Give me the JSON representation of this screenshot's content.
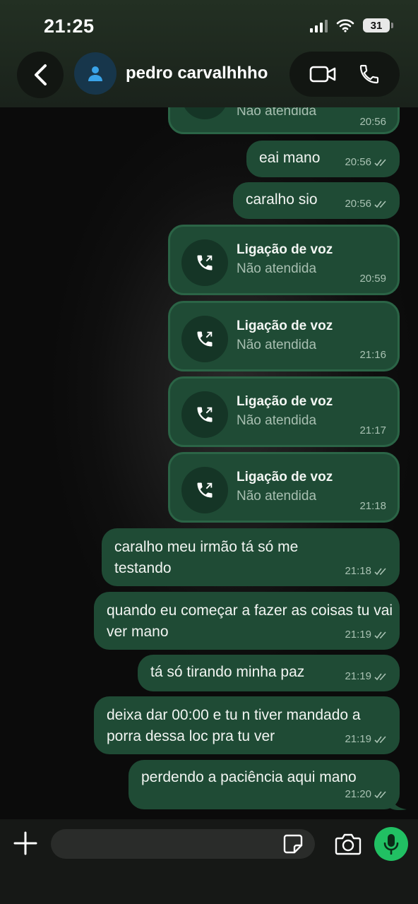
{
  "status_bar": {
    "time": "21:25",
    "battery": "31"
  },
  "header": {
    "contact_name": "pedro carvalhhho"
  },
  "messages": [
    {
      "kind": "call",
      "title": "",
      "status": "Não atendida",
      "time": "20:56"
    },
    {
      "kind": "text",
      "text": "eai mano",
      "time": "20:56"
    },
    {
      "kind": "text",
      "text": "caralho sio",
      "time": "20:56"
    },
    {
      "kind": "call",
      "title": "Ligação de voz",
      "status": "Não atendida",
      "time": "20:59"
    },
    {
      "kind": "call",
      "title": "Ligação de voz",
      "status": "Não atendida",
      "time": "21:16"
    },
    {
      "kind": "call",
      "title": "Ligação de voz",
      "status": "Não atendida",
      "time": "21:17"
    },
    {
      "kind": "call",
      "title": "Ligação de voz",
      "status": "Não atendida",
      "time": "21:18"
    },
    {
      "kind": "text",
      "text": "caralho meu irmão tá só me testando",
      "time": "21:18"
    },
    {
      "kind": "text",
      "text": "quando eu começar a fazer as coisas tu vai ver mano",
      "time": "21:19"
    },
    {
      "kind": "text",
      "text": "tá só tirando minha paz",
      "time": "21:19"
    },
    {
      "kind": "text",
      "text": "deixa dar 00:00 e tu n tiver mandado a porra dessa loc pra tu ver",
      "time": "21:19"
    },
    {
      "kind": "text",
      "text": "perdendo a paciência aqui mano",
      "time": "21:20"
    }
  ],
  "input": {
    "placeholder": ""
  },
  "colors": {
    "bubble": "#1f4b35",
    "mic": "#21c063",
    "header": "#1f2a20"
  },
  "icons": [
    "back-icon",
    "user-icon",
    "video-call-icon",
    "phone-icon",
    "plus-icon",
    "sticker-icon",
    "camera-icon",
    "mic-icon",
    "outgoing-call-icon",
    "double-check-icon"
  ]
}
